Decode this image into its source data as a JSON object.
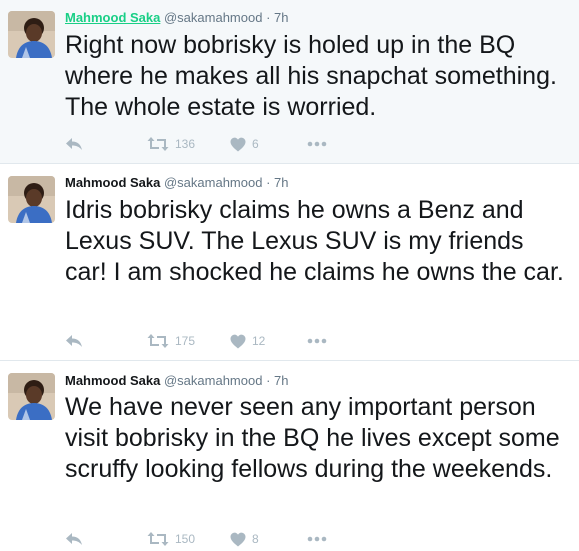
{
  "tweets": [
    {
      "name": "Mahmood Saka",
      "handle": "@sakamahmood",
      "time": "7h",
      "text": "Right now bobrisky is holed up in the BQ where he makes all his snapchat something. The whole estate is worried.",
      "retweets": "136",
      "likes": "6"
    },
    {
      "name": "Mahmood Saka",
      "handle": "@sakamahmood",
      "time": "7h",
      "text": "Idris bobrisky claims he owns a Benz and Lexus SUV. The Lexus SUV is my friends car! I am shocked he claims he owns the car.",
      "retweets": "175",
      "likes": "12"
    },
    {
      "name": "Mahmood Saka",
      "handle": "@sakamahmood",
      "time": "7h",
      "text": "We have never seen any important person visit bobrisky in the BQ he lives except some scruffy looking fellows during the weekends.",
      "retweets": "150",
      "likes": "8"
    }
  ],
  "separator": "·",
  "icons": {
    "reply": "reply-icon",
    "retweet": "retweet-icon",
    "like": "heart-icon",
    "more": "more-icon"
  },
  "colors": {
    "name_highlight": "#19cf86",
    "muted": "#657786",
    "action": "#aab8c2",
    "highlight_bg": "#f5f8fa"
  }
}
